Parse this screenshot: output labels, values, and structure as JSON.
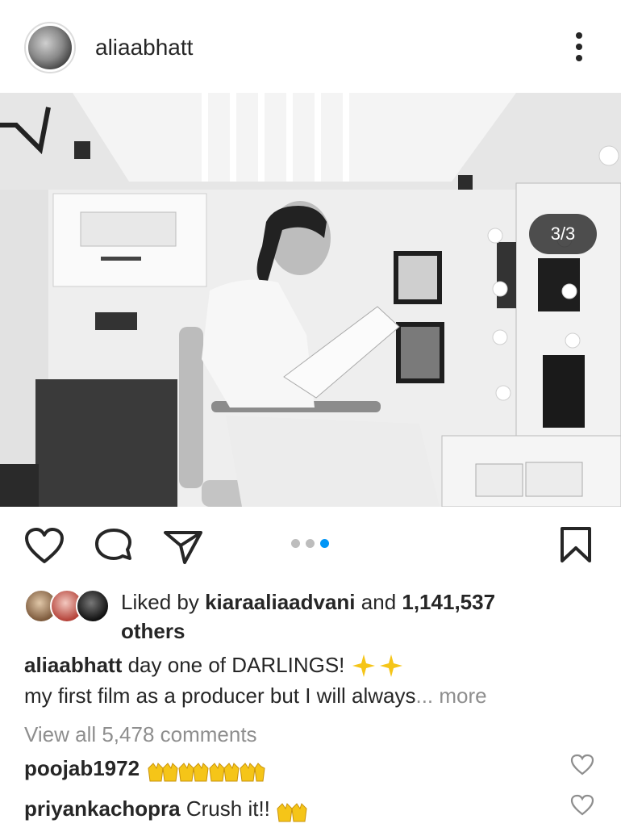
{
  "header": {
    "username": "aliaabhatt",
    "avatar": "profile-avatar",
    "more_icon": "more-vertical-icon"
  },
  "photo": {
    "description_icon": "photo",
    "counter": "3/3",
    "current": 3,
    "total": 3
  },
  "actions": {
    "like_icon": "heart-icon",
    "comment_icon": "comment-icon",
    "share_icon": "send-icon",
    "save_icon": "bookmark-icon",
    "carousel_dots": 3,
    "active_dot": 3
  },
  "likes": {
    "prefix": "Liked by ",
    "user": "kiaraaliaadvani",
    "middle": " and ",
    "count": "1,141,537",
    "suffix": "others"
  },
  "caption": {
    "username": "aliaabhatt",
    "text": " day one of DARLINGS! ",
    "line2": "my first film as a producer but I will always",
    "ellipsis": "...",
    "more": " more"
  },
  "view_all_comments": "View all 5,478 comments",
  "comments": [
    {
      "username": "poojab1972",
      "text": ""
    },
    {
      "username": "priyankachopra",
      "text": " Crush it!! "
    }
  ],
  "colors": {
    "text": "#262626",
    "muted": "#8e8e8e",
    "active_dot": "#0095f6",
    "inactive_dot": "#bdbdbd"
  }
}
